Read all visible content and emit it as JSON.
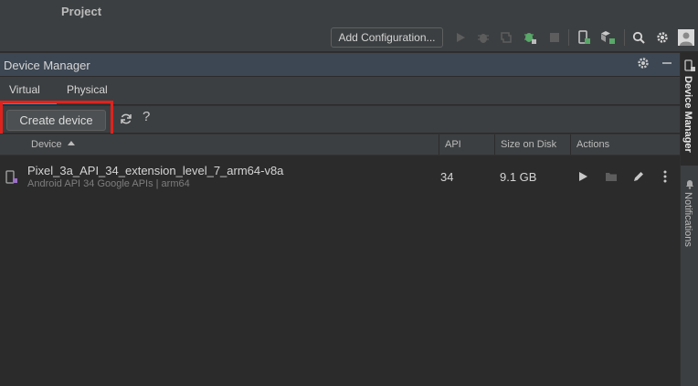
{
  "window": {
    "project_title": "Project"
  },
  "toolbar": {
    "run_config_label": "Add Configuration...",
    "icons": [
      "run-icon",
      "debug-icon",
      "profile-icon",
      "apply-changes-icon",
      "stop-icon",
      "device-manager-icon",
      "sdk-manager-icon",
      "search-icon",
      "settings-icon",
      "avatar-icon"
    ]
  },
  "device_manager": {
    "title": "Device Manager",
    "tabs": [
      {
        "label": "Virtual",
        "selected": true
      },
      {
        "label": "Physical",
        "selected": false
      }
    ],
    "create_button_label": "Create device",
    "help_label": "?",
    "columns": {
      "device": "Device",
      "api": "API",
      "size": "Size on Disk",
      "actions": "Actions"
    },
    "devices": [
      {
        "name": "Pixel_3a_API_34_extension_level_7_arm64-v8a",
        "subtitle": "Android API 34 Google APIs | arm64",
        "api": "34",
        "size": "9.1 GB"
      }
    ]
  },
  "right_strip": {
    "device_manager_label": "Device Manager",
    "notifications_label": "Notifications"
  },
  "colors": {
    "accent": "#4a88c7",
    "highlight": "#e0221d",
    "run_green": "#59a869",
    "header_blue": "#3d4753"
  }
}
